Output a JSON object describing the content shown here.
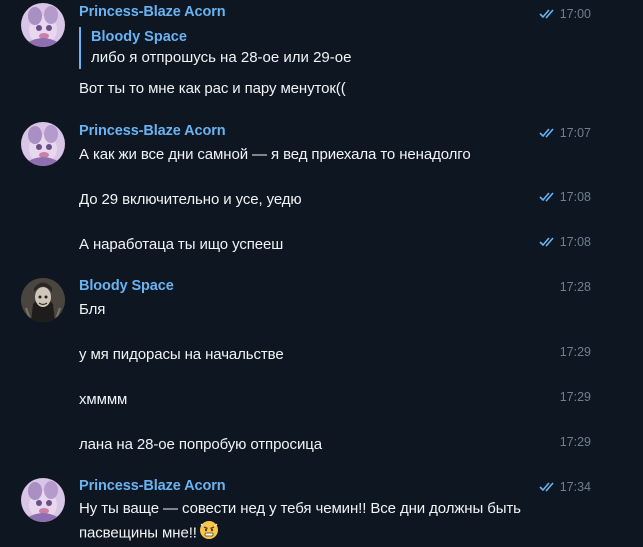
{
  "colors": {
    "background": "#0e1621",
    "accent": "#6ab3f3",
    "message_text": "#f1f4f7",
    "meta_text": "#6d7f8f"
  },
  "groups": [
    {
      "sender": "Princess-Blaze Acorn",
      "avatar": "princess-avatar",
      "reply": {
        "author": "Bloody Space",
        "text": "либо я отпрошусь на 28-ое или 29-ое"
      },
      "messages": [
        {
          "text": "Вот ты то мне как рас и пару менуток((",
          "time": "17:00",
          "read": true
        }
      ]
    },
    {
      "sender": "Princess-Blaze Acorn",
      "avatar": "princess-avatar",
      "messages": [
        {
          "text": "А как жи все дни самной — я вед приехала то ненадолго",
          "time": "17:07",
          "read": true
        },
        {
          "text": "До 29 включительно и усе, уедю",
          "time": "17:08",
          "read": true
        },
        {
          "text": "А наработаца ты ищо успееш",
          "time": "17:08",
          "read": true
        }
      ]
    },
    {
      "sender": "Bloody Space",
      "avatar": "bloody-avatar",
      "messages": [
        {
          "text": "Бля",
          "time": "17:28",
          "read": false
        },
        {
          "text": "у мя пидорасы на начальстве",
          "time": "17:29",
          "read": false
        },
        {
          "text": "хмммм",
          "time": "17:29",
          "read": false
        },
        {
          "text": "лана на 28-ое попробую отпросица",
          "time": "17:29",
          "read": false
        }
      ]
    },
    {
      "sender": "Princess-Blaze Acorn",
      "avatar": "princess-avatar",
      "messages": [
        {
          "text": "Ну ты ваще — совести нед у тебя чемин!! Все дни должны быть пасвещины мне!!",
          "emoji": "angry-face-emoji",
          "time": "17:34",
          "read": true
        }
      ]
    }
  ]
}
